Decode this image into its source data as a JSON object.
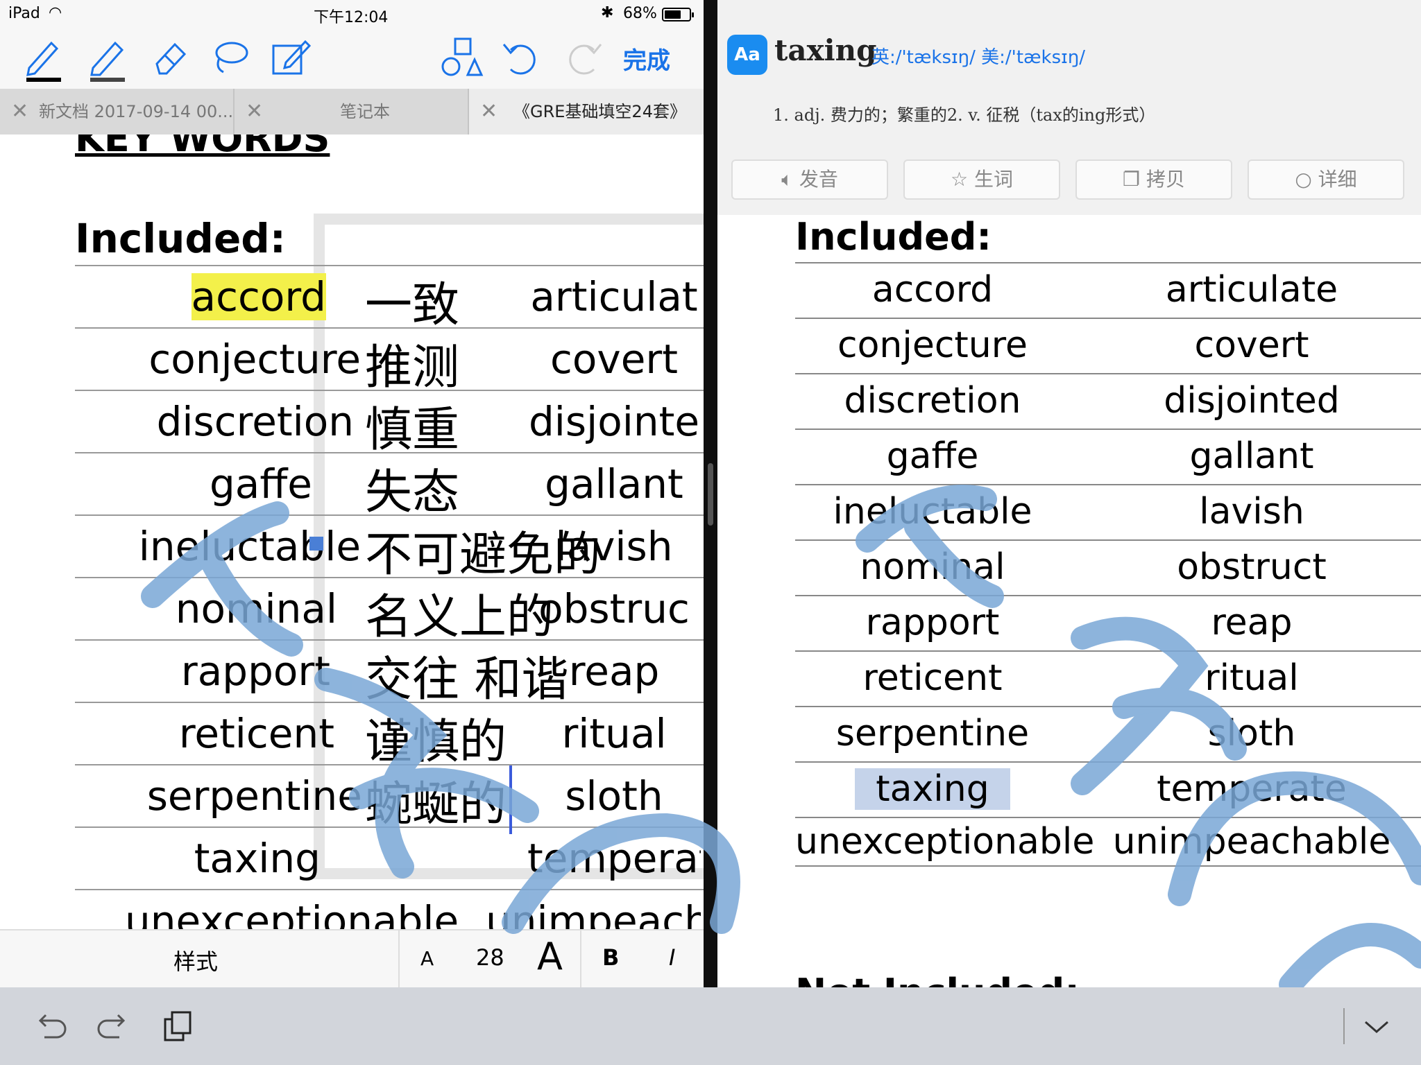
{
  "status": {
    "carrier": "iPad",
    "time": "下午12:04",
    "battery": "68%",
    "battery_level": 0.68
  },
  "toolbar": {
    "done_label": "完成",
    "icons": [
      "pen-icon",
      "highlighter-icon",
      "eraser-icon",
      "lasso-icon",
      "text-edit-icon",
      "shapes-icon",
      "undo-icon",
      "redo-icon"
    ]
  },
  "tabs": [
    {
      "label": "新文档 2017-09-14 00..."
    },
    {
      "label": "笔记本"
    },
    {
      "label": "《GRE基础填空24套》"
    }
  ],
  "left_doc": {
    "key_words_title": "KEY WORDS",
    "included_title": "Included:",
    "rows": [
      {
        "en": "accord",
        "cn": "一致",
        "en2": "articulat"
      },
      {
        "en": "conjecture",
        "cn": "推测",
        "en2": "covert"
      },
      {
        "en": "discretion",
        "cn": "慎重",
        "en2": "disjointe"
      },
      {
        "en": "gaffe",
        "cn": "失态",
        "en2": "gallant"
      },
      {
        "en": "ineluctable",
        "cn": "不可避免的",
        "en2": "lavish"
      },
      {
        "en": "nominal",
        "cn": "名义上的",
        "en2": "obstruc"
      },
      {
        "en": "rapport",
        "cn": "交往 和谐",
        "en2": "reap"
      },
      {
        "en": "reticent",
        "cn": "谨慎的",
        "en2": "ritual"
      },
      {
        "en": "serpentine",
        "cn": "蜿蜒的",
        "en2": "sloth"
      },
      {
        "en": "taxing",
        "cn": "",
        "en2": "temperat"
      },
      {
        "en": "unexceptionable",
        "cn": "",
        "en2": "unimpeach"
      }
    ]
  },
  "format_bar": {
    "style_label": "样式",
    "small_a": "A",
    "font_size": "28",
    "large_a": "A",
    "bold": "B",
    "italic": "I"
  },
  "dictionary": {
    "icon_text": "Aa",
    "word": "taxing",
    "phonetic": "英:/'tæksɪŋ/ 美:/'tæksɪŋ/",
    "definition": "1. adj. 费力的；繁重的2. v. 征税（tax的ing形式）",
    "buttons": [
      {
        "icon": "speaker-icon",
        "label": "发音"
      },
      {
        "icon": "star-icon",
        "label": "生词"
      },
      {
        "icon": "copy-icon",
        "label": "拷贝"
      },
      {
        "icon": "search-icon",
        "label": "详细"
      }
    ]
  },
  "right_doc": {
    "included_title": "Included:",
    "rows": [
      {
        "a": "accord",
        "b": "articulate"
      },
      {
        "a": "conjecture",
        "b": "covert"
      },
      {
        "a": "discretion",
        "b": "disjointed"
      },
      {
        "a": "gaffe",
        "b": "gallant"
      },
      {
        "a": "ineluctable",
        "b": "lavish"
      },
      {
        "a": "nominal",
        "b": "obstruct"
      },
      {
        "a": "rapport",
        "b": "reap"
      },
      {
        "a": "reticent",
        "b": "ritual"
      },
      {
        "a": "serpentine",
        "b": "sloth"
      },
      {
        "a": "taxing",
        "b": "temperate"
      },
      {
        "a": "unexceptionable",
        "b": "unimpeachable"
      }
    ],
    "not_included_title": "Not Included:"
  },
  "colors": {
    "accent": "#1a73e8",
    "highlight_yellow": "#f3f04a",
    "highlight_blue": "#c5d3ea",
    "watermark": "#7aa7d6"
  }
}
